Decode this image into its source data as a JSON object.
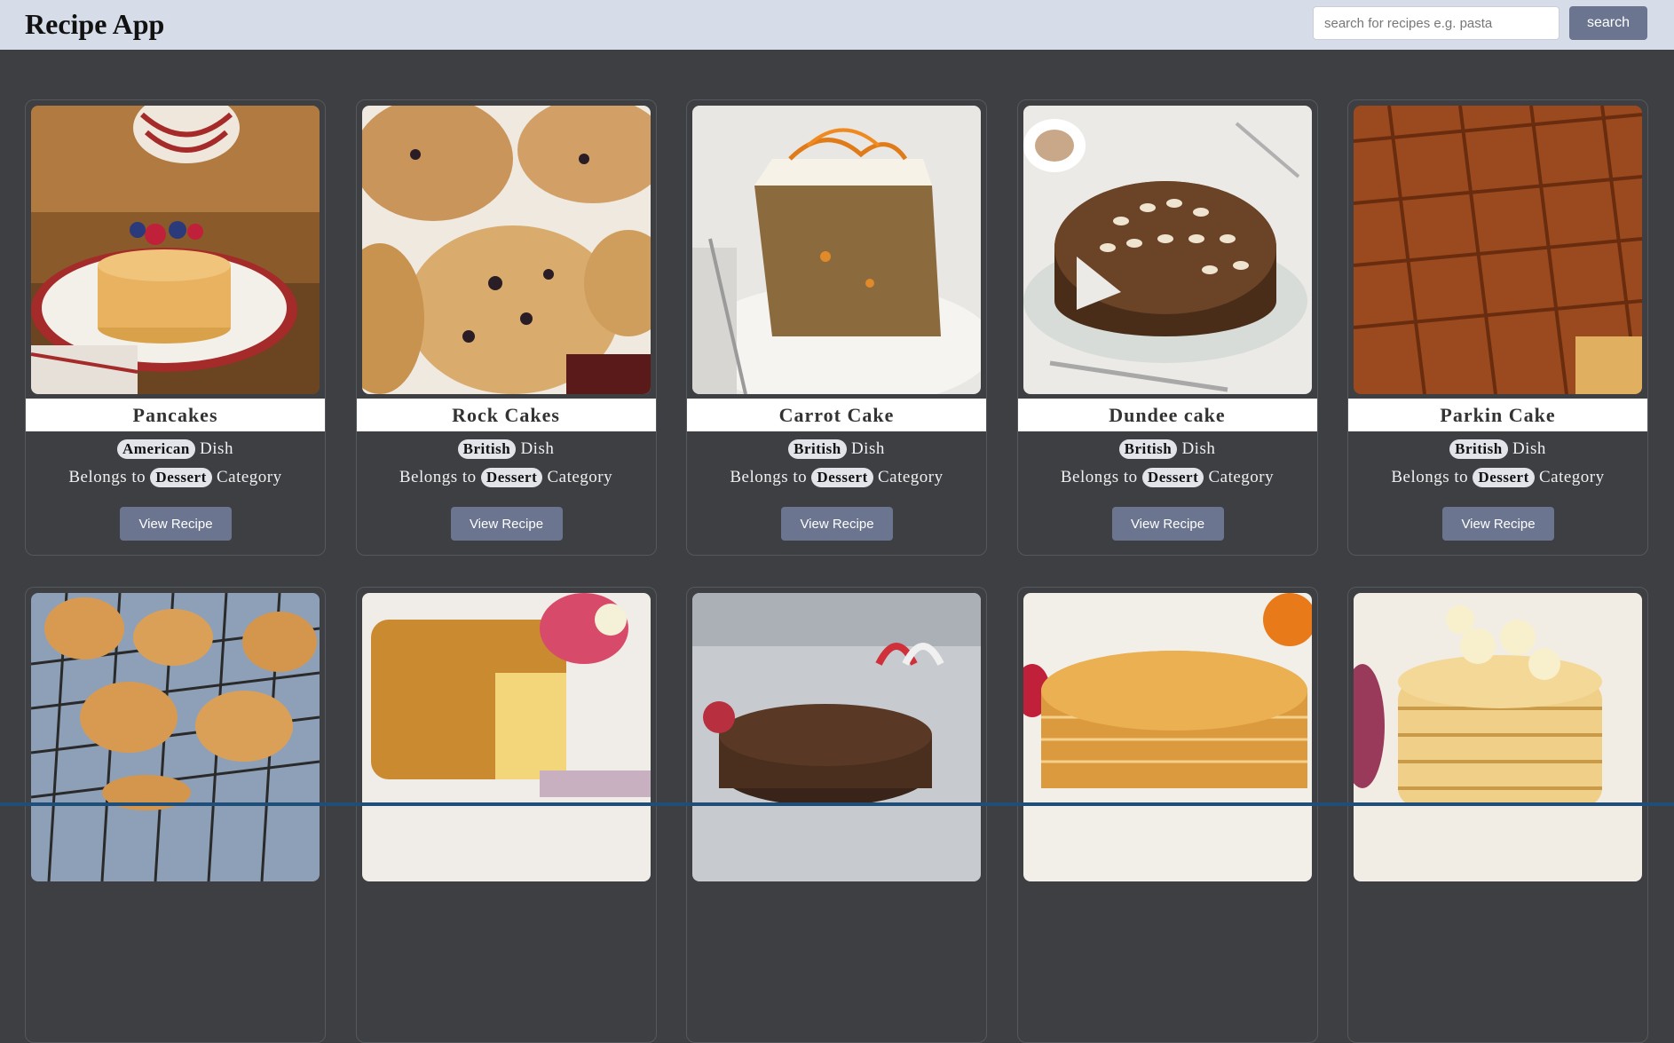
{
  "header": {
    "title": "Recipe App",
    "search_placeholder": "search for recipes e.g. pasta",
    "search_button": "search"
  },
  "cards": [
    {
      "title": "Pancakes",
      "area": "American",
      "dish_text": "Dish",
      "belongs_text": "Belongs to",
      "category": "Dessert",
      "category_text": "Category",
      "button": "View Recipe",
      "image": "pancakes-photo"
    },
    {
      "title": "Rock Cakes",
      "area": "British",
      "dish_text": "Dish",
      "belongs_text": "Belongs to",
      "category": "Dessert",
      "category_text": "Category",
      "button": "View Recipe",
      "image": "rock-cakes-photo"
    },
    {
      "title": "Carrot Cake",
      "area": "British",
      "dish_text": "Dish",
      "belongs_text": "Belongs to",
      "category": "Dessert",
      "category_text": "Category",
      "button": "View Recipe",
      "image": "carrot-cake-photo"
    },
    {
      "title": "Dundee cake",
      "area": "British",
      "dish_text": "Dish",
      "belongs_text": "Belongs to",
      "category": "Dessert",
      "category_text": "Category",
      "button": "View Recipe",
      "image": "dundee-cake-photo"
    },
    {
      "title": "Parkin Cake",
      "area": "British",
      "dish_text": "Dish",
      "belongs_text": "Belongs to",
      "category": "Dessert",
      "category_text": "Category",
      "button": "View Recipe",
      "image": "parkin-cake-photo"
    },
    {
      "image": "pastries-on-rack-photo"
    },
    {
      "image": "pound-cake-photo"
    },
    {
      "image": "christmas-cake-photo"
    },
    {
      "image": "crepes-stack-photo"
    },
    {
      "image": "banana-pancakes-photo"
    }
  ],
  "colors": {
    "header_bg": "#d6dce8",
    "page_bg": "#3d3f42",
    "button_bg": "#6b7590",
    "badge_bg": "#e2e4ea"
  }
}
